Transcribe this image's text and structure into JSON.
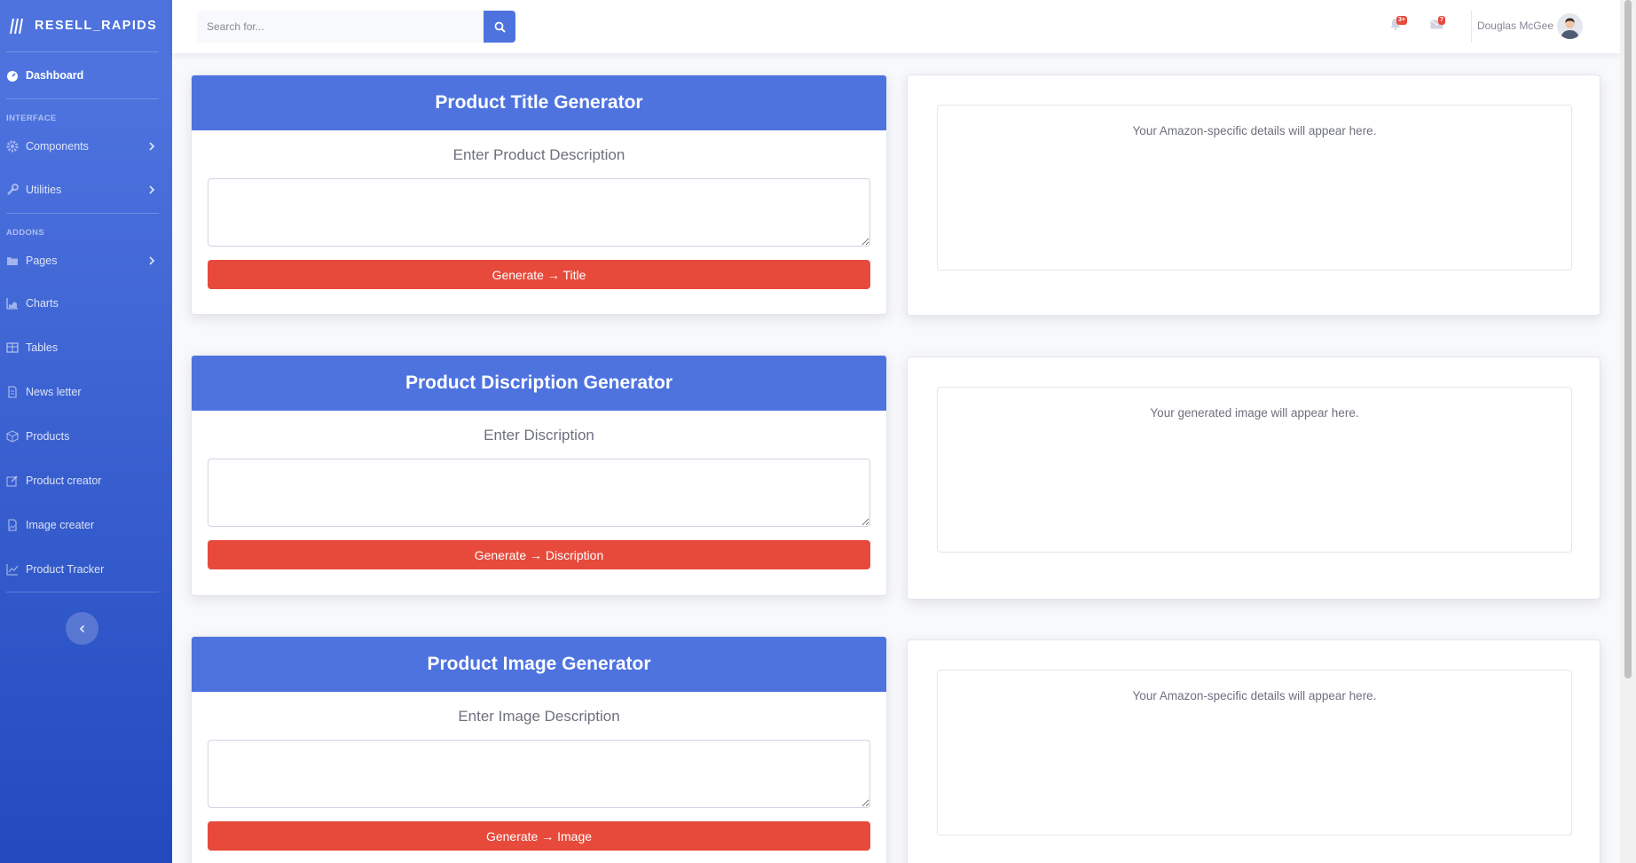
{
  "brand": {
    "name": "RESELL_RAPIDS",
    "icon": "brand-slashes-icon"
  },
  "sidebar": {
    "dashboard": {
      "label": "Dashboard",
      "icon": "dashboard-icon"
    },
    "heading_interface": "INTERFACE",
    "components": {
      "label": "Components",
      "icon": "gear-icon"
    },
    "utilities": {
      "label": "Utilities",
      "icon": "wrench-icon"
    },
    "heading_addons": "ADDONS",
    "pages": {
      "label": "Pages",
      "icon": "folder-icon"
    },
    "charts": {
      "label": "Charts",
      "icon": "chart-area-icon"
    },
    "tables": {
      "label": "Tables",
      "icon": "table-icon"
    },
    "newsletter": {
      "label": "News letter",
      "icon": "file-icon"
    },
    "products": {
      "label": "Products",
      "icon": "box-icon"
    },
    "product_creator": {
      "label": "Product creator",
      "icon": "edit-icon"
    },
    "image_creater": {
      "label": "Image creater",
      "icon": "image-file-icon"
    },
    "product_tracker": {
      "label": "Product Tracker",
      "icon": "line-chart-icon"
    }
  },
  "topbar": {
    "search_placeholder": "Search for...",
    "alerts_badge": "3+",
    "messages_badge": "7",
    "user_name": "Douglas McGee"
  },
  "generators": [
    {
      "title": "Product Title Generator",
      "label": "Enter Product Description",
      "button": "Generate → Title",
      "output": "Your Amazon-specific details will appear here."
    },
    {
      "title": "Product Discription Generator",
      "label": "Enter Discription",
      "button": "Generate → Discription",
      "output": "Your generated image will appear here."
    },
    {
      "title": "Product Image Generator",
      "label": "Enter Image Description",
      "button": "Generate → Image",
      "output": "Your Amazon-specific details will appear here."
    }
  ],
  "colors": {
    "primary": "#4e73df",
    "danger": "#e74a3b",
    "text_muted": "#6e707e"
  }
}
